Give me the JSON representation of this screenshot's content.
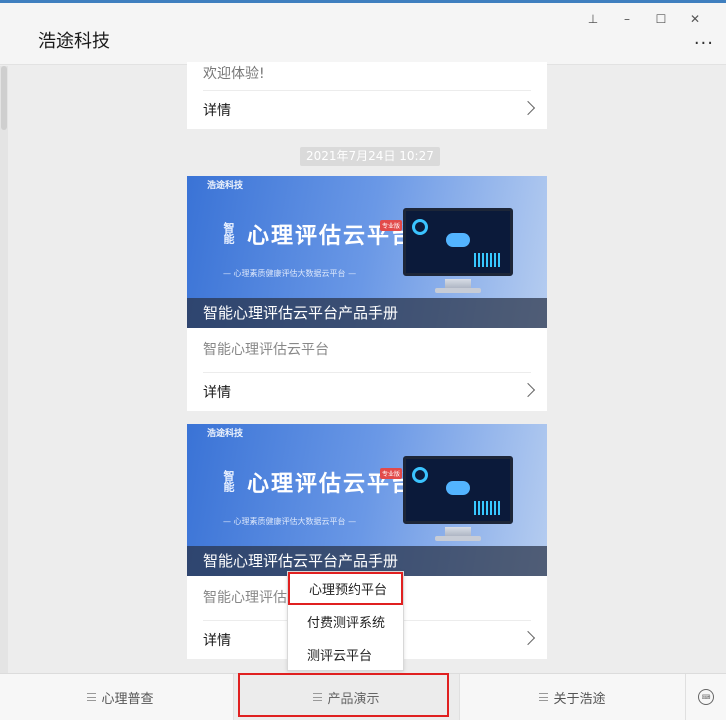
{
  "header": {
    "title": "浩途科技",
    "more": "···"
  },
  "window_controls": {
    "pin": "⊥",
    "minimize": "–",
    "maximize": "☐",
    "close": "✕"
  },
  "card_top": {
    "text": "欢迎体验!",
    "detail_label": "详情"
  },
  "timestamp": "2021年7月24日 10:27",
  "articles": [
    {
      "banner_title": "心理评估云平台",
      "banner_prefix": "智能",
      "banner_badge": "专业版",
      "banner_sub": "— 心理素质健康评估大数据云平台 —",
      "banner_logo": "浩途科技",
      "caption": "智能心理评估云平台产品手册",
      "summary": "智能心理评估云平台",
      "detail_label": "详情"
    },
    {
      "banner_title": "心理评估云平台",
      "banner_prefix": "智能",
      "banner_badge": "专业版",
      "banner_sub": "— 心理素质健康评估大数据云平台 —",
      "banner_logo": "浩途科技",
      "caption": "智能心理评估云平台产品手册",
      "summary": "智能心理评估",
      "detail_label": "详情"
    }
  ],
  "submenu": {
    "items": [
      "心理预约平台",
      "付费测评系统",
      "测评云平台"
    ]
  },
  "bottom_menu": {
    "items": [
      "心理普查",
      "产品演示",
      "关于浩途"
    ],
    "keyboard": "⌨"
  },
  "colors": {
    "highlight": "#e02020",
    "accent": "#3f7fbf"
  }
}
